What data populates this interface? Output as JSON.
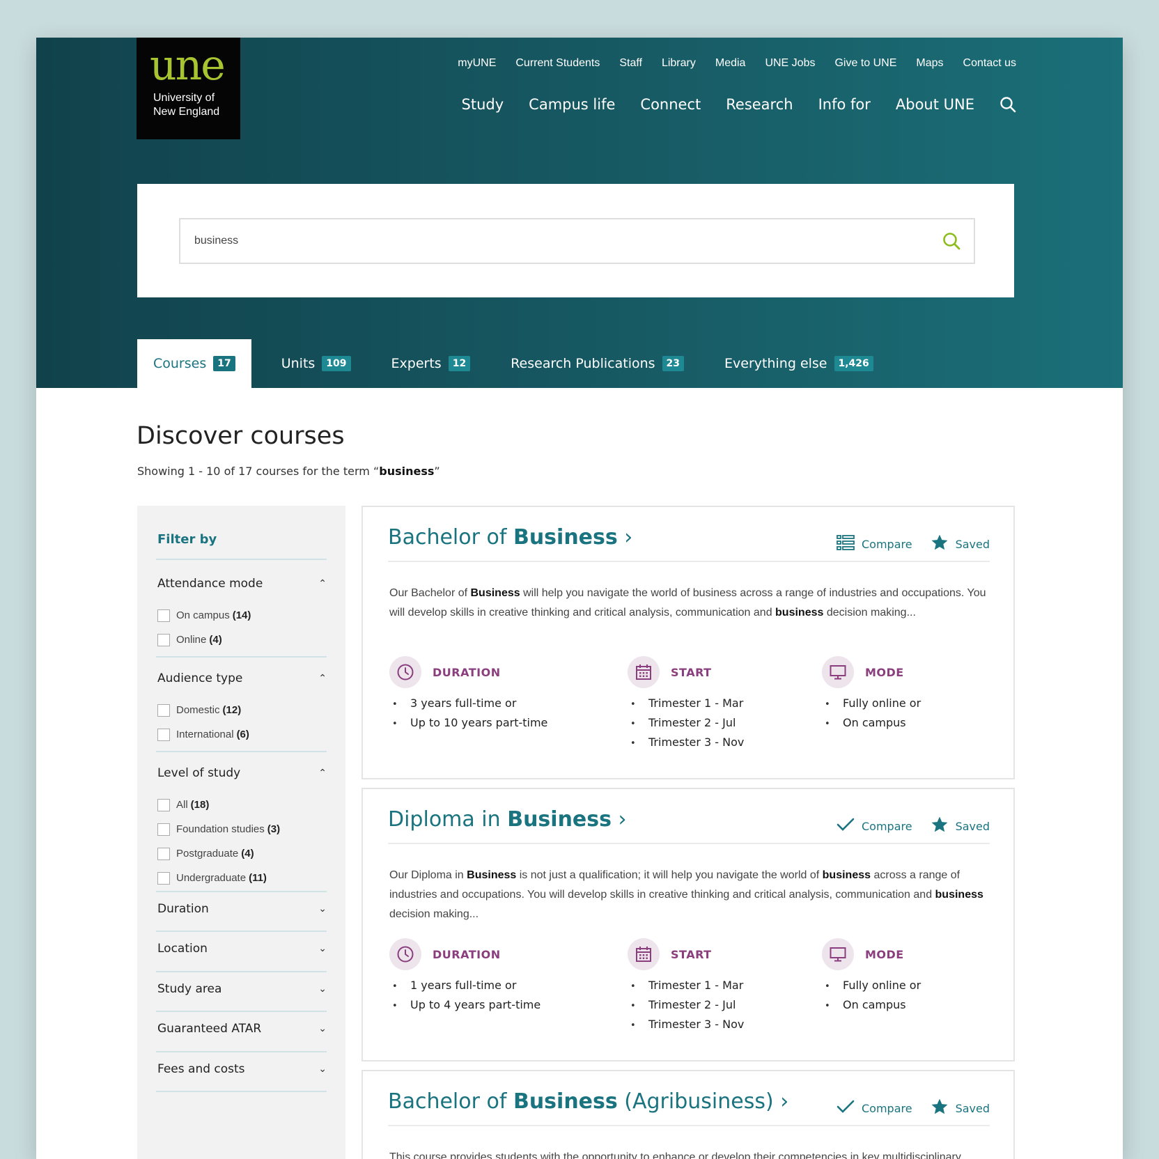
{
  "logo": {
    "mark": "une",
    "line1": "University of",
    "line2": "New England"
  },
  "utility_nav": [
    "myUNE",
    "Current Students",
    "Staff",
    "Library",
    "Media",
    "UNE Jobs",
    "Give to UNE",
    "Maps",
    "Contact us"
  ],
  "main_nav": [
    "Study",
    "Campus life",
    "Connect",
    "Research",
    "Info for",
    "About UNE"
  ],
  "search": {
    "value": "business"
  },
  "tabs": [
    {
      "label": "Courses",
      "count": "17"
    },
    {
      "label": "Units",
      "count": "109"
    },
    {
      "label": "Experts",
      "count": "12"
    },
    {
      "label": "Research Publications",
      "count": "23"
    },
    {
      "label": "Everything else",
      "count": "1,426"
    }
  ],
  "page": {
    "title": "Discover courses",
    "summary_prefix": "Showing 1 - 10 of 17 courses for the term “",
    "summary_term": "business",
    "summary_suffix": "”"
  },
  "filter": {
    "title": "Filter by",
    "groups": [
      {
        "label": "Attendance mode",
        "expanded": true,
        "options": [
          {
            "label": "On campus",
            "count": "(14)"
          },
          {
            "label": "Online",
            "count": "(4)"
          }
        ]
      },
      {
        "label": "Audience type",
        "expanded": true,
        "options": [
          {
            "label": "Domestic",
            "count": "(12)"
          },
          {
            "label": "International",
            "count": "(6)"
          }
        ]
      },
      {
        "label": "Level of study",
        "expanded": true,
        "options": [
          {
            "label": "All",
            "count": "(18)"
          },
          {
            "label": "Foundation studies",
            "count": "(3)"
          },
          {
            "label": "Postgraduate",
            "count": "(4)"
          },
          {
            "label": "Undergraduate",
            "count": "(11)"
          }
        ]
      },
      {
        "label": "Duration",
        "expanded": false
      },
      {
        "label": "Location",
        "expanded": false
      },
      {
        "label": "Study area",
        "expanded": false
      },
      {
        "label": "Guaranteed ATAR",
        "expanded": false
      },
      {
        "label": "Fees and costs",
        "expanded": false
      }
    ]
  },
  "labels": {
    "compare": "Compare",
    "saved": "Saved",
    "duration": "DURATION",
    "start": "START",
    "mode": "MODE"
  },
  "courses": [
    {
      "title_pre": "Bachelor of ",
      "title_bold": "Business",
      "title_post": "",
      "desc": [
        [
          "Our Bachelor of ",
          ""
        ],
        [
          "Business",
          "b"
        ],
        [
          " will help you navigate the world of business across a range of industries and occupations. You will develop skills in creative thinking and critical analysis, communication and ",
          ""
        ],
        [
          "business",
          "b"
        ],
        [
          " decision making...",
          ""
        ]
      ],
      "duration": [
        "3 years full-time or",
        "Up to 10 years part-time"
      ],
      "start": [
        "Trimester 1 - Mar",
        "Trimester 2 - Jul",
        "Trimester 3 - Nov"
      ],
      "mode": [
        "Fully online or",
        "On campus"
      ]
    },
    {
      "title_pre": "Diploma in ",
      "title_bold": "Business",
      "title_post": "",
      "desc": [
        [
          "Our Diploma in ",
          ""
        ],
        [
          "Business",
          "b"
        ],
        [
          " is not just a qualification; it will help you navigate the world of ",
          ""
        ],
        [
          "business",
          "b"
        ],
        [
          " across a range of industries and occupations. You will develop skills in creative thinking and critical analysis, communication and ",
          ""
        ],
        [
          "business",
          "b"
        ],
        [
          " decision making...",
          ""
        ]
      ],
      "duration": [
        "1 years full-time or",
        "Up to 4 years part-time"
      ],
      "start": [
        "Trimester 1 - Mar",
        "Trimester 2 - Jul",
        "Trimester 3 - Nov"
      ],
      "mode": [
        "Fully online or",
        "On campus"
      ]
    },
    {
      "title_pre": "Bachelor of ",
      "title_bold": "Business",
      "title_post": " (Agribusiness)",
      "desc": [
        [
          "This course provides students with the opportunity to enhance or develop their competencies in key multidisciplinary",
          ""
        ]
      ]
    }
  ]
}
